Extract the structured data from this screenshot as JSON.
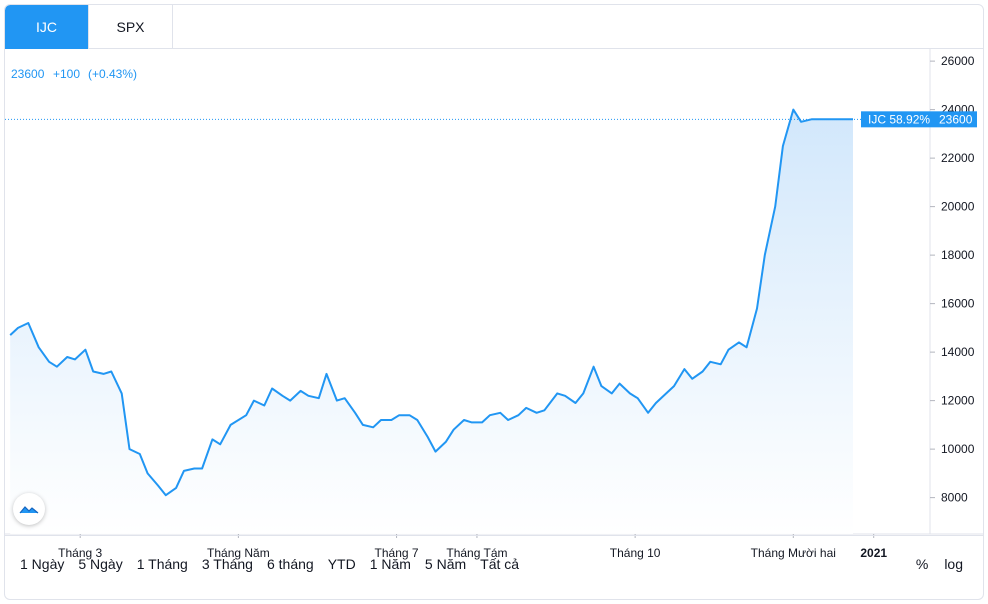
{
  "tabs": [
    {
      "label": "IJC",
      "active": true
    },
    {
      "label": "SPX",
      "active": false
    }
  ],
  "header": {
    "price": "23600",
    "change": "+100",
    "change_pct": "(+0.43%)"
  },
  "price_tag": {
    "symbol_label": "IJC 58.92%",
    "value_label": "23600"
  },
  "ranges": [
    "1 Ngày",
    "5 Ngày",
    "1 Tháng",
    "3 Tháng",
    "6 tháng",
    "YTD",
    "1 Năm",
    "5 Năm",
    "Tất cả"
  ],
  "controls": {
    "percent": "%",
    "log": "log"
  },
  "colors": {
    "accent": "#2196f3",
    "line": "#2196f3",
    "area_top": "#cfe6fb",
    "area_bottom": "#ffffff",
    "grid": "#e0e3eb",
    "text": "#131722"
  },
  "chart_data": {
    "type": "area",
    "series": [
      {
        "name": "IJC"
      }
    ],
    "ylim": [
      6500,
      26500
    ],
    "yticks": [
      8000,
      10000,
      12000,
      14000,
      16000,
      18000,
      20000,
      22000,
      24000,
      26000
    ],
    "xticks": [
      "Tháng 3",
      "Tháng Năm",
      "Tháng 7",
      "Tháng Tám",
      "Tháng 10",
      "Tháng Mười hai",
      "2021"
    ],
    "xtick_bold": [
      false,
      false,
      false,
      false,
      false,
      false,
      true
    ],
    "x": [
      "2020-02-03",
      "2020-02-06",
      "2020-02-10",
      "2020-02-14",
      "2020-02-18",
      "2020-02-21",
      "2020-02-25",
      "2020-02-28",
      "2020-03-03",
      "2020-03-06",
      "2020-03-10",
      "2020-03-13",
      "2020-03-17",
      "2020-03-20",
      "2020-03-24",
      "2020-03-27",
      "2020-03-31",
      "2020-04-03",
      "2020-04-07",
      "2020-04-10",
      "2020-04-14",
      "2020-04-17",
      "2020-04-21",
      "2020-04-24",
      "2020-04-28",
      "2020-05-04",
      "2020-05-07",
      "2020-05-11",
      "2020-05-14",
      "2020-05-18",
      "2020-05-21",
      "2020-05-25",
      "2020-05-28",
      "2020-06-01",
      "2020-06-04",
      "2020-06-08",
      "2020-06-11",
      "2020-06-15",
      "2020-06-18",
      "2020-06-22",
      "2020-06-25",
      "2020-06-29",
      "2020-07-02",
      "2020-07-06",
      "2020-07-09",
      "2020-07-13",
      "2020-07-16",
      "2020-07-20",
      "2020-07-23",
      "2020-07-27",
      "2020-07-30",
      "2020-08-03",
      "2020-08-06",
      "2020-08-10",
      "2020-08-13",
      "2020-08-17",
      "2020-08-20",
      "2020-08-24",
      "2020-08-27",
      "2020-09-01",
      "2020-09-04",
      "2020-09-08",
      "2020-09-11",
      "2020-09-15",
      "2020-09-18",
      "2020-09-22",
      "2020-09-25",
      "2020-09-29",
      "2020-10-02",
      "2020-10-06",
      "2020-10-09",
      "2020-10-13",
      "2020-10-16",
      "2020-10-20",
      "2020-10-23",
      "2020-10-27",
      "2020-10-30",
      "2020-11-03",
      "2020-11-06",
      "2020-11-10",
      "2020-11-13",
      "2020-11-17",
      "2020-11-20",
      "2020-11-24",
      "2020-11-27",
      "2020-12-01",
      "2020-12-04",
      "2020-12-08",
      "2020-12-11",
      "2020-12-15",
      "2020-12-18",
      "2020-12-21",
      "2020-12-24"
    ],
    "values": [
      14700,
      15000,
      15200,
      14200,
      13600,
      13400,
      13800,
      13700,
      14100,
      13200,
      13100,
      13200,
      12300,
      10000,
      9800,
      9000,
      8500,
      8100,
      8400,
      9100,
      9200,
      9200,
      10400,
      10200,
      11000,
      11400,
      12000,
      11800,
      12500,
      12200,
      12000,
      12400,
      12200,
      12100,
      13100,
      12000,
      12100,
      11500,
      11000,
      10900,
      11200,
      11200,
      11400,
      11400,
      11200,
      10500,
      9900,
      10300,
      10800,
      11200,
      11100,
      11100,
      11400,
      11500,
      11200,
      11400,
      11700,
      11500,
      11600,
      12300,
      12200,
      11900,
      12300,
      13400,
      12600,
      12300,
      12700,
      12300,
      12100,
      11500,
      11900,
      12300,
      12600,
      13300,
      12900,
      13200,
      13600,
      13500,
      14100,
      14400,
      14200,
      15800,
      18000,
      20000,
      22500,
      24000,
      23500,
      23600,
      23600,
      23600,
      23600,
      23600,
      23600
    ]
  }
}
